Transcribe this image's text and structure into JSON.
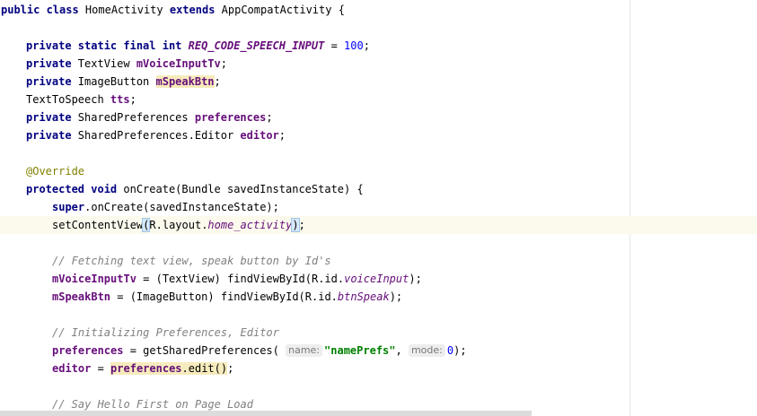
{
  "colors": {
    "keyword": "#000080",
    "field": "#660e7a",
    "number": "#0000ff",
    "string": "#008000",
    "annotation": "#808000",
    "comment": "#808080",
    "usage_highlight": "#f6ebbc",
    "current_line": "#fcfaed"
  },
  "code": {
    "l1": {
      "kw1": "public class",
      "t1": " HomeActivity ",
      "kw2": "extends",
      "t2": " AppCompatActivity {"
    },
    "l2": {
      "kw1": "private static final int",
      "t1": " ",
      "const": "REQ_CODE_SPEECH_INPUT",
      "t2": " = ",
      "num": "100",
      "t3": ";"
    },
    "l3": {
      "kw1": "private",
      "t1": " TextView ",
      "field": "mVoiceInputTv",
      "t2": ";"
    },
    "l4": {
      "kw1": "private",
      "t1": " ImageButton ",
      "field": "mSpeakBtn",
      "t2": ";"
    },
    "l5": {
      "t1": "TextToSpeech ",
      "field": "tts",
      "t2": ";"
    },
    "l6": {
      "kw1": "private",
      "t1": " SharedPreferences ",
      "field": "preferences",
      "t2": ";"
    },
    "l7": {
      "kw1": "private",
      "t1": " SharedPreferences.Editor ",
      "field": "editor",
      "t2": ";"
    },
    "l8": {
      "annot": "@Override"
    },
    "l9": {
      "kw1": "protected void",
      "t1": " onCreate(Bundle savedInstanceState) {"
    },
    "l10": {
      "kw1": "super",
      "t1": ".onCreate(savedInstanceState);"
    },
    "l11": {
      "t1": "setContentView",
      "paren_open": "(",
      "t2": "R.layout.",
      "static_ref": "home_activity",
      "paren_close": ")",
      "t3": ";"
    },
    "l12": {
      "comment": "// Fetching text view, speak button by Id's"
    },
    "l13": {
      "field": "mVoiceInputTv",
      "t1": " = (TextView) findViewById(R.id.",
      "static_ref": "voiceInput",
      "t2": ");"
    },
    "l14": {
      "field": "mSpeakBtn",
      "t1": " = (ImageButton) findViewById(R.id.",
      "static_ref": "btnSpeak",
      "t2": ");"
    },
    "l15": {
      "comment": "// Initializing Preferences, Editor"
    },
    "l16": {
      "field": "preferences",
      "t1": " = getSharedPreferences( ",
      "hint1": "name:",
      "str": "\"namePrefs\"",
      "t2": ", ",
      "hint2": "mode:",
      "num": "0",
      "t3": ");"
    },
    "l17": {
      "field": "editor",
      "t1": " = ",
      "field2": "preferences",
      "t2": ".edit()",
      "t3": ";"
    },
    "l18": {
      "comment": "// Say Hello First on Page Load"
    }
  }
}
